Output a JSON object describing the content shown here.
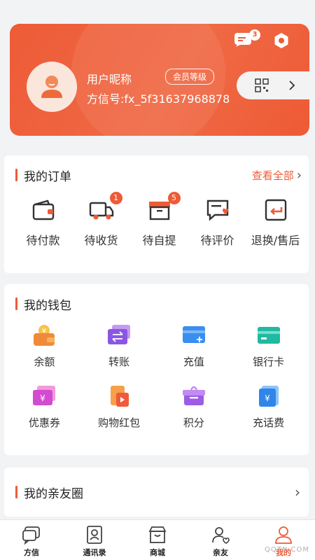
{
  "colors": {
    "accent": "#ee5b37",
    "background": "#f2f3f5"
  },
  "profile": {
    "nickname": "用户昵称",
    "member_level": "会员等级",
    "account_id": "方信号:fx_5f31637968878",
    "message_count": "3",
    "icons": [
      "message-icon",
      "settings-icon",
      "qr-code-icon",
      "chevron-right-icon"
    ]
  },
  "orders": {
    "title": "我的订单",
    "view_all": "查看全部",
    "items": [
      {
        "label": "待付款",
        "icon": "wallet-icon",
        "badge": ""
      },
      {
        "label": "待收货",
        "icon": "truck-icon",
        "badge": "1"
      },
      {
        "label": "待自提",
        "icon": "box-icon",
        "badge": "5"
      },
      {
        "label": "待评价",
        "icon": "review-icon",
        "badge": ""
      },
      {
        "label": "退换/售后",
        "icon": "return-icon",
        "badge": ""
      }
    ]
  },
  "wallet": {
    "title": "我的钱包",
    "items": [
      {
        "label": "余额",
        "icon": "balance-icon"
      },
      {
        "label": "转账",
        "icon": "transfer-icon"
      },
      {
        "label": "充值",
        "icon": "recharge-icon"
      },
      {
        "label": "银行卡",
        "icon": "bank-card-icon"
      },
      {
        "label": "优惠券",
        "icon": "coupon-icon"
      },
      {
        "label": "购物红包",
        "icon": "red-packet-icon"
      },
      {
        "label": "积分",
        "icon": "points-icon"
      },
      {
        "label": "充话费",
        "icon": "phone-bill-icon"
      }
    ]
  },
  "friends": {
    "title": "我的亲友圈"
  },
  "bottom_nav": [
    {
      "label": "方信",
      "icon": "chat-icon",
      "active": false
    },
    {
      "label": "通讯录",
      "icon": "contacts-icon",
      "active": false
    },
    {
      "label": "商城",
      "icon": "store-icon",
      "active": false
    },
    {
      "label": "亲友",
      "icon": "friends-icon",
      "active": false
    },
    {
      "label": "我的",
      "icon": "profile-icon",
      "active": true
    }
  ],
  "watermark": "QQTN.COM"
}
